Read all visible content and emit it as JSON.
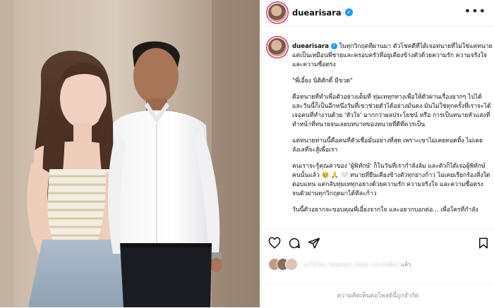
{
  "post": {
    "username": "duearisara",
    "more_label": "•••"
  },
  "caption": {
    "p1": "ในทุกวิกฤตที่ผ่านมา ตัวโชคดีที่ได้เจอทนายที่ไม่ใช่แค่ทนาย แต่เป็นเหมือนพี่ชายและครอบครัวที่อยู่เคียงข้างตัวด้วยความรัก ความจริงใจ และความซื่อตรง",
    "p2": "\"พี่เอี๋ยง นิติศักดิ์ มีขวด\"",
    "p3": "คือทนายที่ทำเพื่อตัวอย่างเต็มที่ ทุ่มเททุกทางเพื่อให้ตัวผ่านเรื่องยากๆ ไปได้ และวันนี้ก็เป็นอีกหนึ่งวันที่เขาช่วยตัวได้อย่างมั่นคง มันไม่ใช่ทุกครั้งที่เราจะได้เจอคนที่ทำงานด้วย 'หัวใจ' มากกว่าผลประโยชน์ หรือ การเป็นทนายหัวแสงที่ทำหน้าที่ทนายจนเลยบทบาทของทนายที่ดีที่ควรเป็น",
    "p4": "แต่ทนายท่านนี้คือคนที่ตัวเชื่อมั่นอย่างที่สุด เพราะเขาไม่เคยทอดทิ้ง ไม่เคยลังเลที่จะสู้เพื่อเรา",
    "p5": "คนเราจะรู้คุณค่าของ 'ผู้พิทักษ์' ก็ในวันที่เรากำลังล้ม และตัวก็ได้เจอผู้พิทักษ์คนนั้นแล้ว 🥹 🙏 🤍 ทนายที่ยืนเคียงข้างตัวทุกย่างก้าว ไม่เคยเรียกร้องสิ่งใดตอบแทน แต่กลับทุ่มเททุกอย่างด้วยความรัก ความจริงใจ และความซื่อตรง จนตัวผ่านทุกวิกฤตมาได้ทีละก้าว",
    "p6": "วันนี้ตัวอยากจะขอบคุณพี่เอี๋ยงจากใจ และอยากบอกต่อ... เพื่อใครที่กำลัง"
  },
  "likes": {
    "blurred_text": "ถูกใจโดย lalapopo_baby และคนอื่นๆ",
    "suffix": "แล้ว"
  },
  "comments_disabled": "ความคิดเห็นต่อโพสต์นี้ถูกจำกัด",
  "colors": {
    "verified": "#1d9bf0",
    "story_ring": "#e1306c",
    "muted": "#8e8e8e"
  },
  "icons": [
    "heart-icon",
    "comment-icon",
    "share-icon",
    "bookmark-icon",
    "more-icon",
    "verified-icon"
  ]
}
